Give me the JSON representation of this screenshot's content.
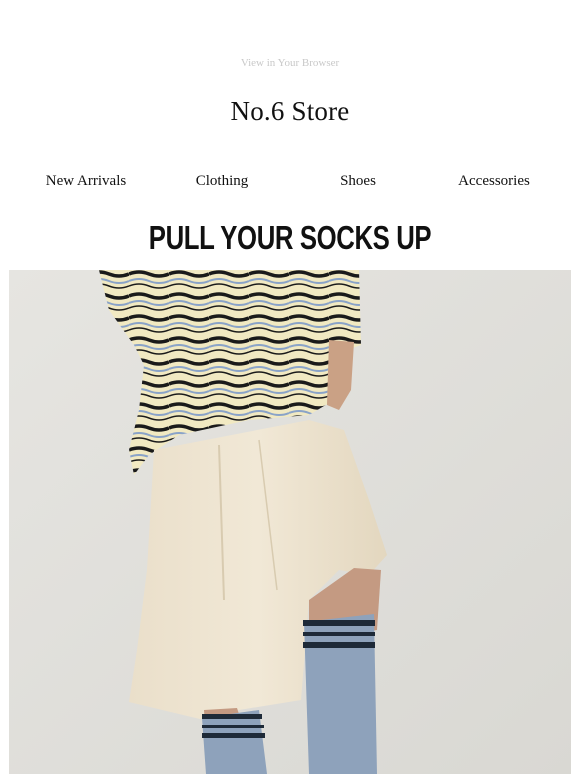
{
  "header": {
    "view_in_browser": "View in Your Browser",
    "brand": "No.6 Store"
  },
  "nav": {
    "items": [
      "New Arrivals",
      "Clothing",
      "Shoes",
      "Accessories"
    ]
  },
  "hero": {
    "headline": "PULL YOUR SOCKS UP"
  },
  "colors": {
    "background": "#ffffff",
    "text": "#111111",
    "muted_link": "#c9c9c9",
    "photo_backdrop": "#e2e1dd"
  }
}
